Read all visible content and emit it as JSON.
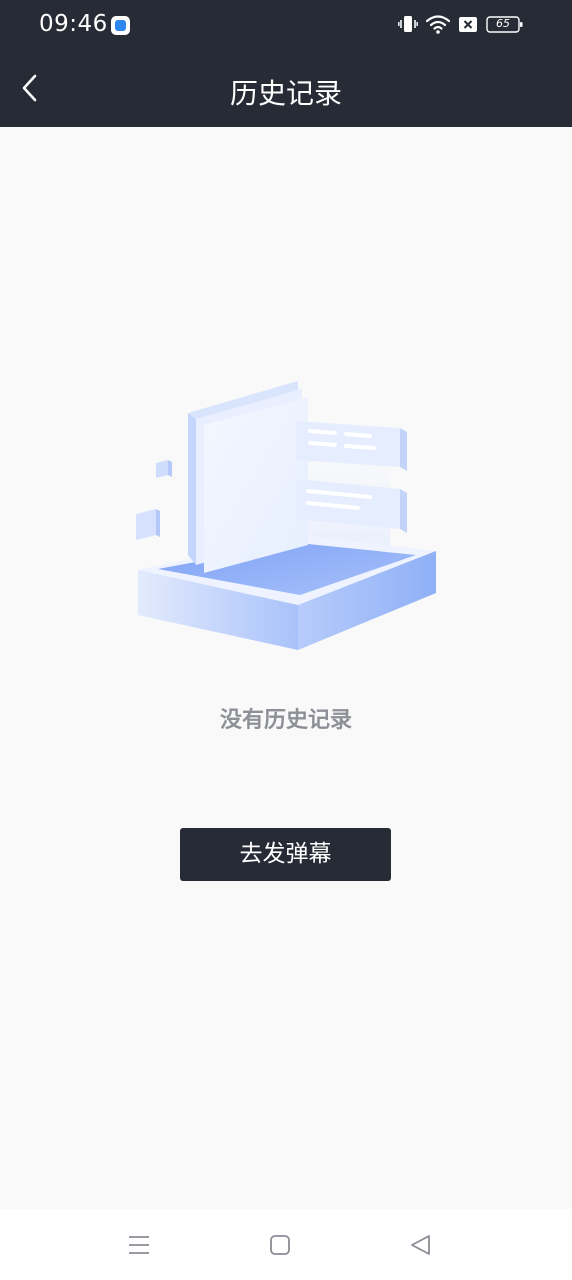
{
  "status_bar": {
    "time": "09:46",
    "battery": "65",
    "icons": [
      "app-notification-icon",
      "vibrate-icon",
      "wifi-icon",
      "sim-off-icon",
      "battery-icon"
    ]
  },
  "header": {
    "title": "历史记录",
    "back_icon": "chevron-left-icon"
  },
  "empty_state": {
    "illustration": "empty-document-box-illustration",
    "message": "没有历史记录",
    "button_label": "去发弹幕"
  },
  "nav_bar": {
    "items": [
      "menu-icon",
      "home-icon",
      "back-triangle-icon"
    ]
  },
  "colors": {
    "header_bg": "#272b35",
    "page_bg": "#f9f9f9",
    "button_bg": "#272b35",
    "empty_text": "#8e9097",
    "illustration_blue": "#8fb0f7"
  }
}
